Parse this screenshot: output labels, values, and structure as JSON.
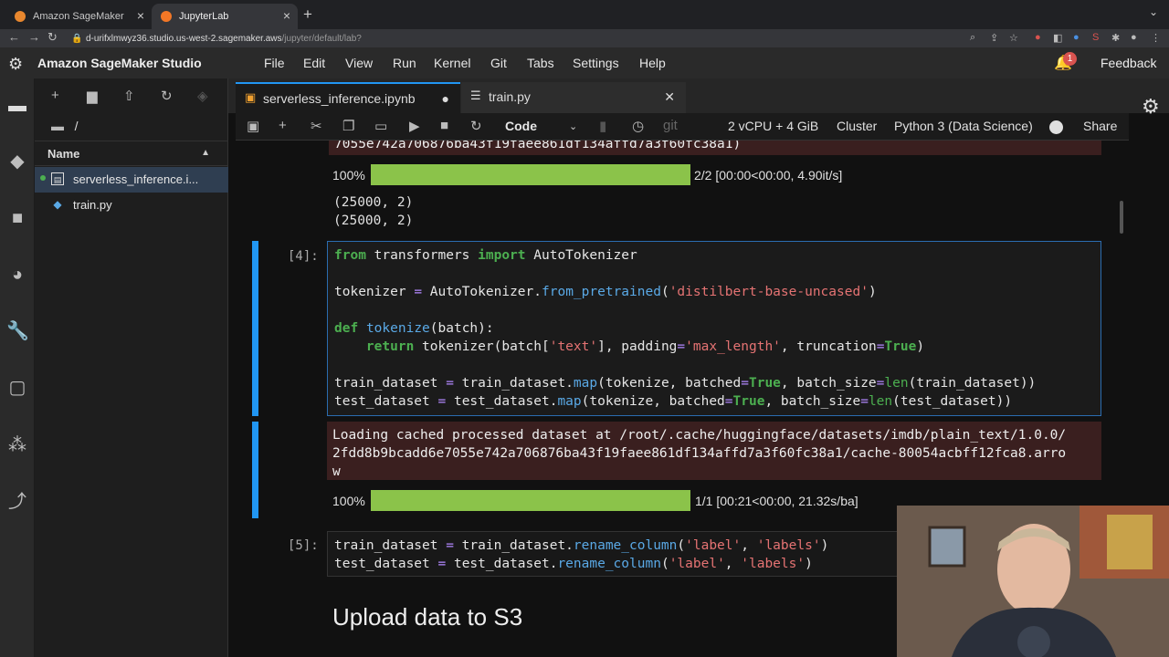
{
  "browser": {
    "tabs": [
      {
        "label": "Amazon SageMaker"
      },
      {
        "label": "JupyterLab"
      }
    ],
    "url_host": "d-urifxlmwyz36.studio.us-west-2.sagemaker.aws",
    "url_path": "/jupyter/default/lab?"
  },
  "studio": {
    "title": "Amazon SageMaker Studio",
    "menus": [
      "File",
      "Edit",
      "View",
      "Run",
      "Kernel",
      "Git",
      "Tabs",
      "Settings",
      "Help"
    ],
    "notifications": "1",
    "feedback": "Feedback"
  },
  "filebrowser": {
    "breadcrumb": "/",
    "column_header": "Name",
    "files": [
      {
        "name": "serverless_inference.i...",
        "selected": true
      },
      {
        "name": "train.py",
        "selected": false
      }
    ]
  },
  "doctabs": [
    {
      "label": "serverless_inference.ipynb"
    },
    {
      "label": "train.py"
    }
  ],
  "toolbar": {
    "cell_type": "Code",
    "instance": "2 vCPU + 4 GiB",
    "cluster": "Cluster",
    "kernel": "Python 3 (Data Science)",
    "share": "Share"
  },
  "notebook": {
    "top_error_tail": "7055e742a706876ba43f19faee861df134affd7a3f60fc38a1)",
    "progress1": {
      "pct": "100%",
      "fraction": 1.0,
      "text": "2/2 [00:00<00:00, 4.90it/s]"
    },
    "shape_lines": [
      "(25000, 2)",
      "(25000, 2)"
    ],
    "cell4_prompt": "[4]:",
    "cell4_output": "Loading cached processed dataset at /root/.cache/huggingface/datasets/imdb/plain_text/1.0.0/\n2fdd8b9bcadd6e7055e742a706876ba43f19faee861df134affd7a3f60fc38a1/cache-80054acbff12fca8.arro\nw",
    "progress2": {
      "pct": "100%",
      "fraction": 1.0,
      "text": "1/1 [00:21<00:00, 21.32s/ba]"
    },
    "cell5_prompt": "[5]:",
    "heading": "Upload data to S3"
  }
}
